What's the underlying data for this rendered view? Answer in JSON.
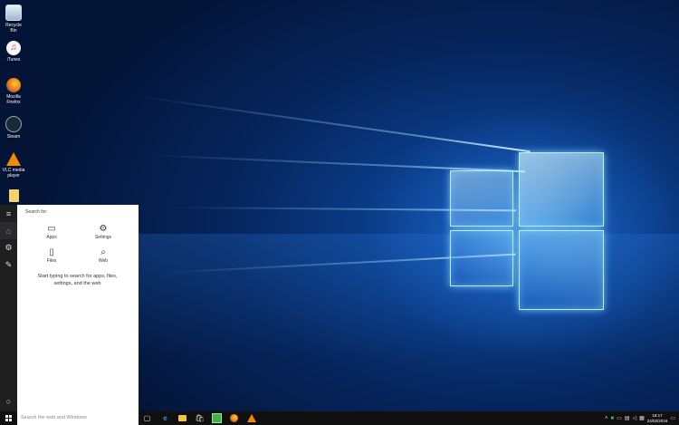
{
  "desktop": {
    "icons": [
      {
        "name": "recycle-bin-icon",
        "label": "Recycle Bin",
        "color": "#bcd2e8"
      },
      {
        "name": "itunes-icon",
        "label": "iTunes",
        "color": "#f2f2f2"
      },
      {
        "name": "firefox-icon",
        "label": "Mozilla\nFirefox",
        "color": "#e8741c"
      },
      {
        "name": "steam-icon",
        "label": "Steam",
        "color": "#1b2838"
      },
      {
        "name": "vlc-icon",
        "label": "VLC media\nplayer",
        "color": "#f08a00"
      },
      {
        "name": "folder-icon",
        "label": "",
        "color": "#f4d36b"
      }
    ]
  },
  "search_panel": {
    "search_for": "Search for:",
    "categories": [
      {
        "label": "Apps",
        "icon": "apps-icon"
      },
      {
        "label": "Settings",
        "icon": "gear-icon"
      },
      {
        "label": "Files",
        "icon": "file-icon"
      },
      {
        "label": "Web",
        "icon": "search-icon"
      }
    ],
    "hint": "Start typing to search for apps, files, settings, and the web"
  },
  "taskbar": {
    "search_placeholder": "Search the web and Windows",
    "pinned": [
      "task-view-icon",
      "edge-icon",
      "file-explorer-icon",
      "store-icon",
      "green-app-icon",
      "firefox-icon",
      "vlc-icon"
    ],
    "clock_time": "18:17",
    "clock_date": "24/02/2016"
  },
  "colors": {
    "accent": "#4aa3ff",
    "taskbar": "#101010",
    "rail": "#1f1f1f"
  }
}
